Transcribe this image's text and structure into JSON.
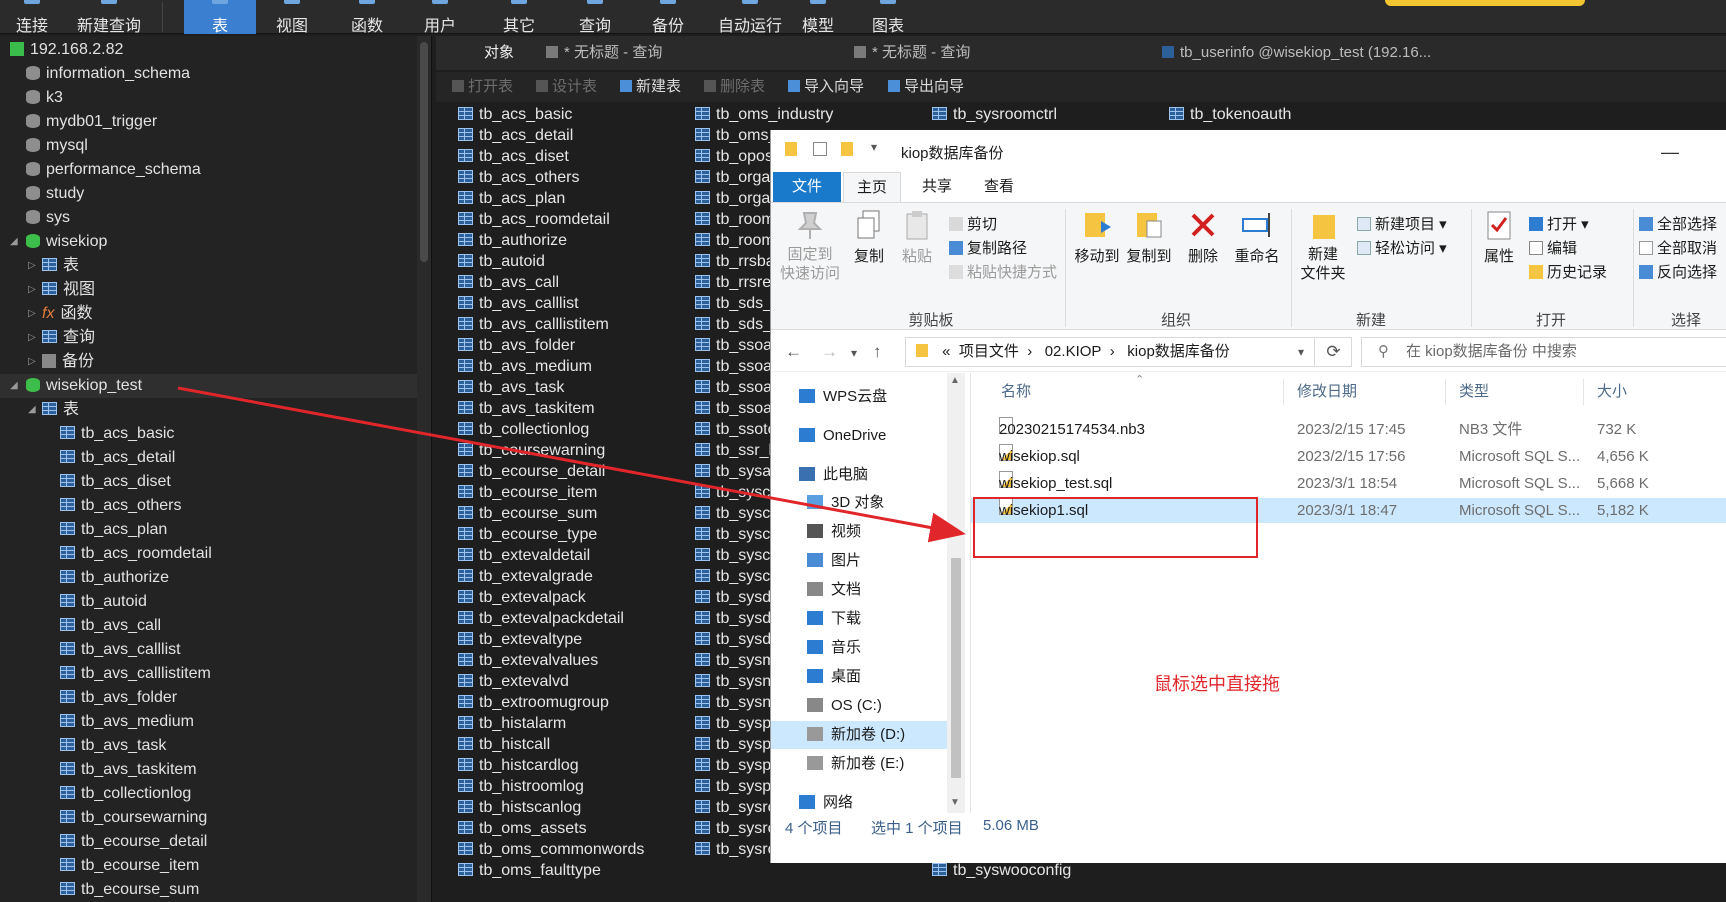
{
  "toolbar": {
    "items": [
      "连接",
      "新建查询",
      "表",
      "视图",
      "函数",
      "用户",
      "其它",
      "查询",
      "备份",
      "自动运行",
      "模型",
      "图表"
    ],
    "active": "表"
  },
  "tree": {
    "server": "192.168.2.82",
    "databases": [
      "information_schema",
      "k3",
      "mydb01_trigger",
      "mysql",
      "performance_schema",
      "study",
      "sys",
      "wisekiop"
    ],
    "wisekiop_children": [
      "表",
      "视图",
      "函数",
      "查询",
      "备份"
    ],
    "selected_db": "wisekiop_test",
    "selected_db_child": "表",
    "tables": [
      "tb_acs_basic",
      "tb_acs_detail",
      "tb_acs_diset",
      "tb_acs_others",
      "tb_acs_plan",
      "tb_acs_roomdetail",
      "tb_authorize",
      "tb_autoid",
      "tb_avs_call",
      "tb_avs_calllist",
      "tb_avs_calllistitem",
      "tb_avs_folder",
      "tb_avs_medium",
      "tb_avs_task",
      "tb_avs_taskitem",
      "tb_collectionlog",
      "tb_coursewarning",
      "tb_ecourse_detail",
      "tb_ecourse_item",
      "tb_ecourse_sum"
    ]
  },
  "tabs": [
    "对象",
    "* 无标题 - 查询",
    "* 无标题 - 查询",
    "tb_userinfo @wisekiop_test (192.16..."
  ],
  "actions": [
    {
      "label": "打开表",
      "enabled": false
    },
    {
      "label": "设计表",
      "enabled": false
    },
    {
      "label": "新建表",
      "enabled": true
    },
    {
      "label": "删除表",
      "enabled": false
    },
    {
      "label": "导入向导",
      "enabled": true
    },
    {
      "label": "导出向导",
      "enabled": true
    }
  ],
  "objects": {
    "col1": [
      "tb_acs_basic",
      "tb_acs_detail",
      "tb_acs_diset",
      "tb_acs_others",
      "tb_acs_plan",
      "tb_acs_roomdetail",
      "tb_authorize",
      "tb_autoid",
      "tb_avs_call",
      "tb_avs_calllist",
      "tb_avs_calllistitem",
      "tb_avs_folder",
      "tb_avs_medium",
      "tb_avs_task",
      "tb_avs_taskitem",
      "tb_collectionlog",
      "tb_coursewarning",
      "tb_ecourse_detail",
      "tb_ecourse_item",
      "tb_ecourse_sum",
      "tb_ecourse_type",
      "tb_extevaldetail",
      "tb_extevalgrade",
      "tb_extevalpack",
      "tb_extevalpackdetail",
      "tb_extevaltype",
      "tb_extevalvalues",
      "tb_extevalvd",
      "tb_extroomugroup",
      "tb_histalarm",
      "tb_histcall",
      "tb_histcardlog",
      "tb_histroomlog",
      "tb_histscanlog",
      "tb_oms_assets",
      "tb_oms_commonwords",
      "tb_oms_faulttype"
    ],
    "col2": [
      "tb_oms_industry",
      "tb_oms_",
      "tb_opos",
      "tb_orga",
      "tb_orga",
      "tb_room",
      "tb_room",
      "tb_rrsba",
      "tb_rrsre",
      "tb_sds_c",
      "tb_sds_i",
      "tb_ssoac",
      "tb_ssoap",
      "tb_ssoap",
      "tb_ssoau",
      "tb_ssotc",
      "tb_ssr_b",
      "tb_sysal",
      "tb_syscl",
      "tb_syscl",
      "tb_sysco",
      "tb_sysco",
      "tb_sysco",
      "tb_sysde",
      "tb_sysdi",
      "tb_sysdi",
      "tb_sysm",
      "tb_sysne",
      "tb_sysne",
      "tb_syspl",
      "tb_syspl",
      "tb_syspl",
      "tb_syspl",
      "tb_sysrc",
      "tb_sysrc",
      "tb_sysroomchannel"
    ],
    "col3_top": "tb_sysroomctrl",
    "col3_bottom": "tb_syswooconfig",
    "col4_top": "tb_tokenoauth"
  },
  "explorer": {
    "title": "kiop数据库备份",
    "ribbon_tabs": [
      "文件",
      "主页",
      "共享",
      "查看"
    ],
    "clipboard": {
      "pin": "固定到\n快速访问",
      "copy": "复制",
      "paste": "粘贴",
      "cut": "剪切",
      "copy_path": "复制路径",
      "paste_shortcut": "粘贴快捷方式",
      "group": "剪贴板"
    },
    "organize": {
      "move_to": "移动到",
      "copy_to": "复制到",
      "delete": "删除",
      "rename": "重命名",
      "group": "组织"
    },
    "new": {
      "new_folder": "新建\n文件夹",
      "new_item": "新建项目",
      "easy_access": "轻松访问",
      "group": "新建"
    },
    "open": {
      "properties": "属性",
      "open": "打开",
      "edit": "编辑",
      "history": "历史记录",
      "group": "打开"
    },
    "select": {
      "select_all": "全部选择",
      "select_none": "全部取消",
      "invert": "反向选择",
      "group": "选择"
    },
    "breadcrumb": [
      "«",
      "项目文件",
      "02.KIOP",
      "kiop数据库备份"
    ],
    "search_placeholder": "在 kiop数据库备份 中搜索",
    "nav": [
      "WPS云盘",
      "OneDrive",
      "此电脑",
      "3D 对象",
      "视频",
      "图片",
      "文档",
      "下载",
      "音乐",
      "桌面",
      "OS (C:)",
      "新加卷 (D:)",
      "新加卷 (E:)",
      "网络"
    ],
    "nav_selected": "新加卷 (D:)",
    "columns": [
      "名称",
      "修改日期",
      "类型",
      "大小"
    ],
    "files": [
      {
        "name": "20230215174534.nb3",
        "date": "2023/2/15 17:45",
        "type": "NB3 文件",
        "size": "732 K"
      },
      {
        "name": "wisekiop.sql",
        "date": "2023/2/15 17:56",
        "type": "Microsoft SQL S...",
        "size": "4,656 K"
      },
      {
        "name": "wisekiop_test.sql",
        "date": "2023/3/1 18:54",
        "type": "Microsoft SQL S...",
        "size": "5,668 K"
      },
      {
        "name": "wisekiop1.sql",
        "date": "2023/3/1 18:47",
        "type": "Microsoft SQL S...",
        "size": "5,182 K"
      }
    ],
    "selected_file": "wisekiop1.sql",
    "status": {
      "count": "4 个项目",
      "selected": "选中 1 个项目",
      "size": "5.06 MB"
    }
  },
  "annotation": "鼠标选中直接拖",
  "colors": {
    "accent": "#3a7fd0",
    "red": "#e1262b",
    "selection": "#cce8ff"
  }
}
